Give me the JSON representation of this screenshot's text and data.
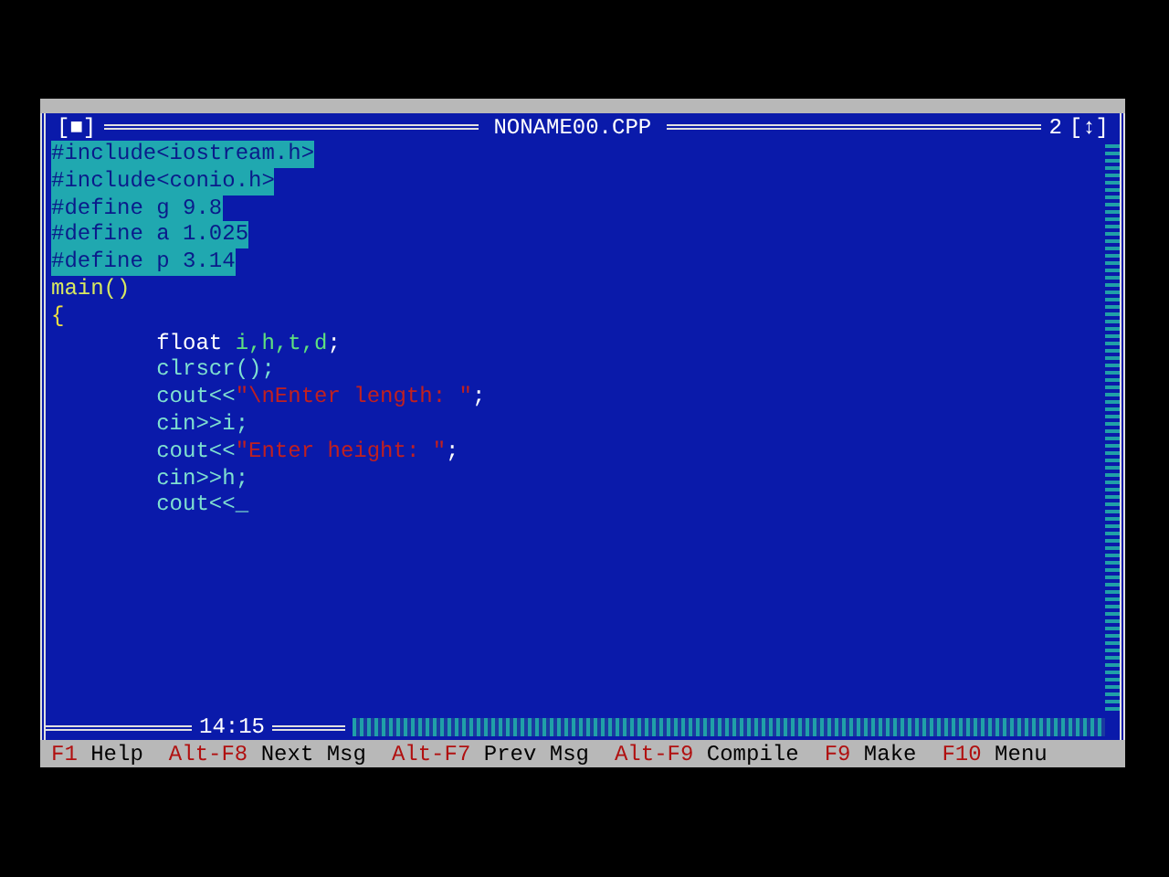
{
  "window": {
    "close_box": "[■]",
    "title": "NONAME00.CPP",
    "number": "2",
    "zoom_box": "[↕]"
  },
  "editor": {
    "lines": [
      {
        "selected": true,
        "tokens": [
          {
            "kind": "plain",
            "text": "#include<iostream.h>"
          }
        ]
      },
      {
        "selected": true,
        "tokens": [
          {
            "kind": "plain",
            "text": "#include<conio.h>"
          }
        ]
      },
      {
        "selected": true,
        "tokens": [
          {
            "kind": "plain",
            "text": "#define g 9.8"
          }
        ]
      },
      {
        "selected": true,
        "tokens": [
          {
            "kind": "plain",
            "text": "#define a 1.025"
          }
        ]
      },
      {
        "selected": true,
        "tokens": [
          {
            "kind": "plain",
            "text": "#define p 3.14"
          }
        ]
      },
      {
        "selected": false,
        "tokens": [
          {
            "kind": "function",
            "text": "main()"
          }
        ]
      },
      {
        "selected": false,
        "tokens": [
          {
            "kind": "brace",
            "text": "{"
          }
        ]
      },
      {
        "selected": false,
        "tokens": [
          {
            "kind": "keyword",
            "text": "        float "
          },
          {
            "kind": "ident",
            "text": "i,h,t,d"
          },
          {
            "kind": "keyword",
            "text": ";"
          }
        ]
      },
      {
        "selected": false,
        "tokens": [
          {
            "kind": "plain",
            "text": "        clrscr();"
          }
        ]
      },
      {
        "selected": false,
        "tokens": [
          {
            "kind": "plain",
            "text": "        cout<<"
          },
          {
            "kind": "string",
            "text": "\"\\nEnter length: \""
          },
          {
            "kind": "keyword",
            "text": ";"
          }
        ]
      },
      {
        "selected": false,
        "tokens": [
          {
            "kind": "plain",
            "text": "        cin>>i;"
          }
        ]
      },
      {
        "selected": false,
        "tokens": [
          {
            "kind": "plain",
            "text": "        cout<<"
          },
          {
            "kind": "string",
            "text": "\"Enter height: \""
          },
          {
            "kind": "keyword",
            "text": ";"
          }
        ]
      },
      {
        "selected": false,
        "tokens": [
          {
            "kind": "plain",
            "text": "        cin>>h;"
          }
        ]
      },
      {
        "selected": false,
        "tokens": [
          {
            "kind": "plain",
            "text": "        cout<<_"
          }
        ]
      }
    ],
    "position": "14:15"
  },
  "status_bar": [
    {
      "key": "F1",
      "label": "Help"
    },
    {
      "key": "Alt-F8",
      "label": "Next Msg"
    },
    {
      "key": "Alt-F7",
      "label": "Prev Msg"
    },
    {
      "key": "Alt-F9",
      "label": "Compile"
    },
    {
      "key": "F9",
      "label": "Make"
    },
    {
      "key": "F10",
      "label": "Menu"
    }
  ]
}
